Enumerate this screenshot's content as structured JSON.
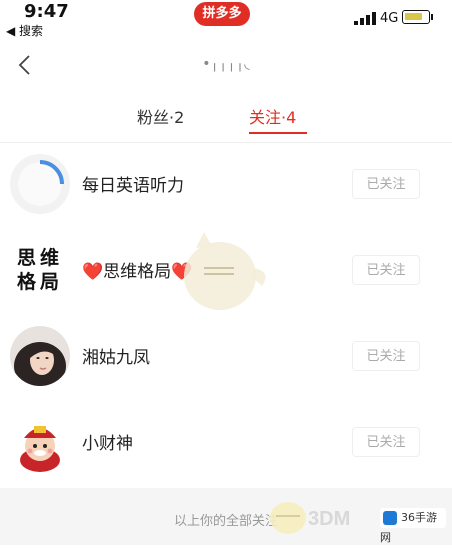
{
  "status_bar": {
    "time": "9:47",
    "back_label": "◀ 搜索",
    "app_badge": "拼多多",
    "network": "4G",
    "battery_level": 0.8
  },
  "navbar": {
    "title": "•╷╷╷╷◟",
    "back_icon": "chevron-left-icon"
  },
  "tabs": {
    "fans": "粉丝·2",
    "following": "关注·4",
    "active": "following"
  },
  "following_list": [
    {
      "name": "每日英语听力",
      "button": "已关注"
    },
    {
      "name": "❤️思维格局❤️",
      "button": "已关注",
      "avatar_text": "思维\n格局"
    },
    {
      "name": "湘姑九凤",
      "button": "已关注"
    },
    {
      "name": "小财神",
      "button": "已关注"
    }
  ],
  "footer": {
    "text": "以上你的全部关注",
    "watermark": "3DM",
    "site_badge": "36手游网"
  },
  "colors": {
    "accent": "#e02e24",
    "muted_text": "#aaaaaa",
    "footer_bg": "#f5f5f5"
  }
}
